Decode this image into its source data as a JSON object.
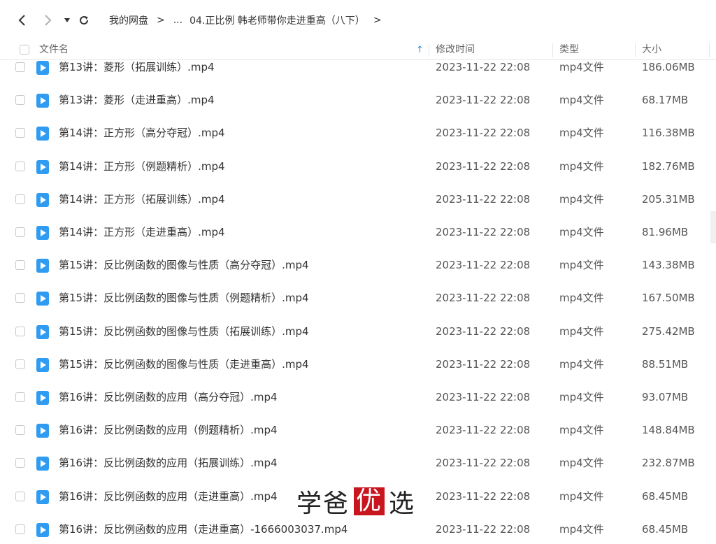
{
  "toolbar": {
    "breadcrumb": [
      {
        "label": "我的网盘"
      },
      {
        "label": "..."
      },
      {
        "label": "04.正比例 韩老师带你走进重高（八下）"
      }
    ]
  },
  "columns": {
    "name": "文件名",
    "modified": "修改时间",
    "type": "类型",
    "size": "大小"
  },
  "files": [
    {
      "name": "第13讲：菱形（拓展训练）.mp4",
      "modified": "2023-11-22 22:08",
      "type": "mp4文件",
      "size": "186.06MB"
    },
    {
      "name": "第13讲：菱形（走进重高）.mp4",
      "modified": "2023-11-22 22:08",
      "type": "mp4文件",
      "size": "68.17MB"
    },
    {
      "name": "第14讲：正方形（高分夺冠）.mp4",
      "modified": "2023-11-22 22:08",
      "type": "mp4文件",
      "size": "116.38MB"
    },
    {
      "name": "第14讲：正方形（例题精析）.mp4",
      "modified": "2023-11-22 22:08",
      "type": "mp4文件",
      "size": "182.76MB"
    },
    {
      "name": "第14讲：正方形（拓展训练）.mp4",
      "modified": "2023-11-22 22:08",
      "type": "mp4文件",
      "size": "205.31MB"
    },
    {
      "name": "第14讲：正方形（走进重高）.mp4",
      "modified": "2023-11-22 22:08",
      "type": "mp4文件",
      "size": "81.96MB"
    },
    {
      "name": "第15讲：反比例函数的图像与性质（高分夺冠）.mp4",
      "modified": "2023-11-22 22:08",
      "type": "mp4文件",
      "size": "143.38MB"
    },
    {
      "name": "第15讲：反比例函数的图像与性质（例题精析）.mp4",
      "modified": "2023-11-22 22:08",
      "type": "mp4文件",
      "size": "167.50MB"
    },
    {
      "name": "第15讲：反比例函数的图像与性质（拓展训练）.mp4",
      "modified": "2023-11-22 22:08",
      "type": "mp4文件",
      "size": "275.42MB"
    },
    {
      "name": "第15讲：反比例函数的图像与性质（走进重高）.mp4",
      "modified": "2023-11-22 22:08",
      "type": "mp4文件",
      "size": "88.51MB"
    },
    {
      "name": "第16讲：反比例函数的应用（高分夺冠）.mp4",
      "modified": "2023-11-22 22:08",
      "type": "mp4文件",
      "size": "93.07MB"
    },
    {
      "name": "第16讲：反比例函数的应用（例题精析）.mp4",
      "modified": "2023-11-22 22:08",
      "type": "mp4文件",
      "size": "148.84MB"
    },
    {
      "name": "第16讲：反比例函数的应用（拓展训练）.mp4",
      "modified": "2023-11-22 22:08",
      "type": "mp4文件",
      "size": "232.87MB"
    },
    {
      "name": "第16讲：反比例函数的应用（走进重高）.mp4",
      "modified": "2023-11-22 22:08",
      "type": "mp4文件",
      "size": "68.45MB"
    },
    {
      "name": "第16讲：反比例函数的应用（走进重高）-1666003037.mp4",
      "modified": "2023-11-22 22:08",
      "type": "mp4文件",
      "size": "68.45MB"
    }
  ],
  "watermark": {
    "a": "学爸",
    "b": "优",
    "c": "选"
  }
}
